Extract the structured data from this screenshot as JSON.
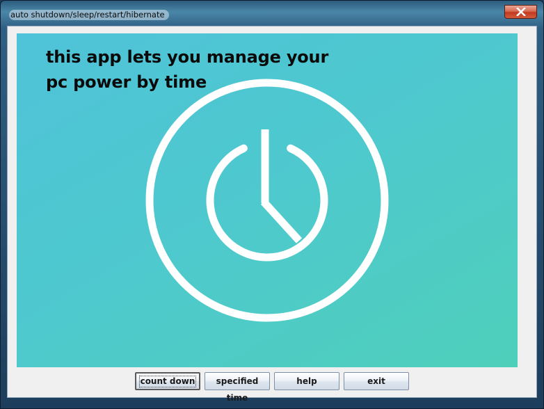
{
  "window": {
    "title": "auto shutdown/sleep/restart/hibernate"
  },
  "hero": {
    "line1": "this app lets you manage your",
    "line2": "pc power by time",
    "background_colors": [
      "#4fc3d9",
      "#4ecfba"
    ]
  },
  "buttons": {
    "count_down": "count down",
    "specified_time": "specified time",
    "help": "help",
    "exit": "exit"
  },
  "icons": {
    "close": "close-icon",
    "power_clock": "power-clock-icon"
  }
}
